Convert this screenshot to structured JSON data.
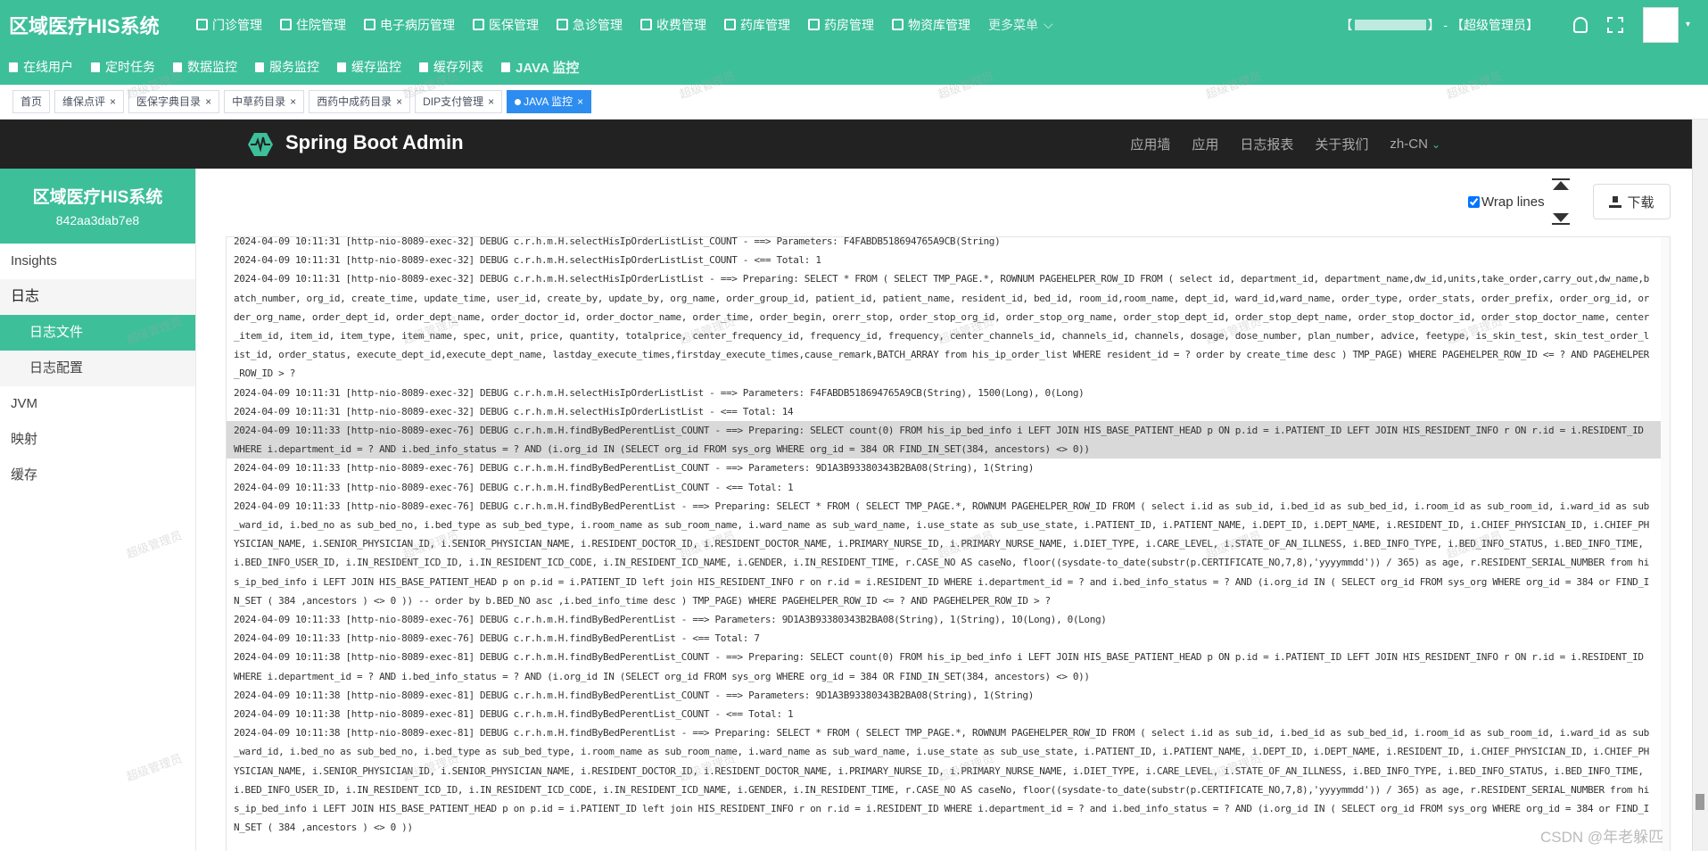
{
  "app": {
    "title": "区域医疗HIS系统",
    "nav": [
      {
        "label": "门诊管理"
      },
      {
        "label": "住院管理"
      },
      {
        "label": "电子病历管理"
      },
      {
        "label": "医保管理"
      },
      {
        "label": "急诊管理"
      },
      {
        "label": "收费管理"
      },
      {
        "label": "药库管理"
      },
      {
        "label": "药房管理"
      },
      {
        "label": "物资库管理"
      }
    ],
    "more_label": "更多菜单",
    "more_caret": "⌵",
    "user_prefix": "【",
    "user_suffix": "】 - 【超级管理员】",
    "avatar_caret": "▾"
  },
  "subnav": [
    {
      "label": "在线用户"
    },
    {
      "label": "定时任务"
    },
    {
      "label": "数据监控"
    },
    {
      "label": "服务监控"
    },
    {
      "label": "缓存监控"
    },
    {
      "label": "缓存列表"
    },
    {
      "label": "JAVA 监控"
    }
  ],
  "tabs": [
    {
      "label": "首页"
    },
    {
      "label": "维保点评",
      "close": "×"
    },
    {
      "label": "医保字典目录",
      "close": "×"
    },
    {
      "label": "中草药目录",
      "close": "×"
    },
    {
      "label": "西药中成药目录",
      "close": "×"
    },
    {
      "label": "DIP支付管理",
      "close": "×"
    },
    {
      "label": "JAVA 监控",
      "close": "×"
    }
  ],
  "sba": {
    "title": "Spring Boot Admin",
    "nav": [
      "应用墙",
      "应用",
      "日志报表",
      "关于我们"
    ],
    "lang": "zh-CN",
    "lang_caret": "⌄"
  },
  "sidebar": {
    "title": "区域医疗HIS系统",
    "instance_id": "842aa3dab7e8",
    "items": [
      {
        "label": "Insights"
      },
      {
        "label": "日志"
      },
      {
        "label": "日志文件"
      },
      {
        "label": "日志配置"
      },
      {
        "label": "JVM"
      },
      {
        "label": "映射"
      },
      {
        "label": "缓存"
      }
    ]
  },
  "logfile": {
    "wrap_label": "Wrap lines",
    "wrap_checked": true,
    "download_label": "下载",
    "lines": [
      "2024-04-09 10:11:31 [http-nio-8089-exec-32] DEBUG c.r.h.m.H.selectHisIpOrderListList_COUNT - ==> Parameters: F4FABDB518694765A9CB(String)",
      "2024-04-09 10:11:31 [http-nio-8089-exec-32] DEBUG c.r.h.m.H.selectHisIpOrderListList_COUNT - <==      Total: 1",
      "2024-04-09 10:11:31 [http-nio-8089-exec-32] DEBUG c.r.h.m.H.selectHisIpOrderListList - ==>  Preparing: SELECT * FROM ( SELECT TMP_PAGE.*, ROWNUM PAGEHELPER_ROW_ID FROM ( select id, department_id, department_name,dw_id,units,take_order,carry_out,dw_name,batch_number, org_id, create_time, update_time, user_id, create_by, update_by, org_name, order_group_id, patient_id, patient_name, resident_id, bed_id, room_id,room_name, dept_id, ward_id,ward_name, order_type, order_stats, order_prefix, order_org_id, order_org_name, order_dept_id, order_dept_name, order_doctor_id, order_doctor_name, order_time, order_begin, orerr_stop, order_stop_org_id, order_stop_org_name, order_stop_dept_id, order_stop_dept_name, order_stop_doctor_id, order_stop_doctor_name, center_item_id, item_id, item_type, item_name, spec, unit, price, quantity, totalprice, center_frequency_id, frequency_id, frequency, center_channels_id, channels_id, channels, dosage, dose_number, plan_number, advice, feetype, is_skin_test, skin_test_order_list_id, order_status, execute_dept_id,execute_dept_name, lastday_execute_times,firstday_execute_times,cause_remark,BATCH_ARRAY from his_ip_order_list WHERE resident_id = ? order by create_time desc ) TMP_PAGE) WHERE PAGEHELPER_ROW_ID <= ? AND PAGEHELPER_ROW_ID > ?",
      "2024-04-09 10:11:31 [http-nio-8089-exec-32] DEBUG c.r.h.m.H.selectHisIpOrderListList - ==> Parameters: F4FABDB518694765A9CB(String), 1500(Long), 0(Long)",
      "2024-04-09 10:11:31 [http-nio-8089-exec-32] DEBUG c.r.h.m.H.selectHisIpOrderListList - <==      Total: 14",
      "2024-04-09 10:11:33 [http-nio-8089-exec-76] DEBUG c.r.h.m.H.findByBedPerentList_COUNT - ==>  Preparing: SELECT count(0) FROM his_ip_bed_info i LEFT JOIN HIS_BASE_PATIENT_HEAD p ON p.id = i.PATIENT_ID LEFT JOIN HIS_RESIDENT_INFO r ON r.id = i.RESIDENT_ID WHERE i.department_id = ? AND i.bed_info_status = ? AND (i.org_id IN (SELECT org_id FROM sys_org WHERE org_id = 384 OR FIND_IN_SET(384, ancestors) <> 0))",
      "2024-04-09 10:11:33 [http-nio-8089-exec-76] DEBUG c.r.h.m.H.findByBedPerentList_COUNT - ==> Parameters: 9D1A3B93380343B2BA08(String), 1(String)",
      "2024-04-09 10:11:33 [http-nio-8089-exec-76] DEBUG c.r.h.m.H.findByBedPerentList_COUNT - <==      Total: 1",
      "2024-04-09 10:11:33 [http-nio-8089-exec-76] DEBUG c.r.h.m.H.findByBedPerentList - ==>  Preparing: SELECT * FROM ( SELECT TMP_PAGE.*, ROWNUM PAGEHELPER_ROW_ID FROM ( select i.id as sub_id, i.bed_id as sub_bed_id, i.room_id as sub_room_id, i.ward_id as sub_ward_id, i.bed_no as sub_bed_no, i.bed_type as sub_bed_type, i.room_name as sub_room_name, i.ward_name as sub_ward_name, i.use_state as sub_use_state, i.PATIENT_ID, i.PATIENT_NAME, i.DEPT_ID, i.DEPT_NAME, i.RESIDENT_ID, i.CHIEF_PHYSICIAN_ID, i.CHIEF_PHYSICIAN_NAME, i.SENIOR_PHYSICIAN_ID, i.SENIOR_PHYSICIAN_NAME, i.RESIDENT_DOCTOR_ID, i.RESIDENT_DOCTOR_NAME, i.PRIMARY_NURSE_ID, i.PRIMARY_NURSE_NAME, i.DIET_TYPE, i.CARE_LEVEL, i.STATE_OF_AN_ILLNESS, i.BED_INFO_TYPE, i.BED_INFO_STATUS, i.BED_INFO_TIME, i.BED_INFO_USER_ID, i.IN_RESIDENT_ICD_ID, i.IN_RESIDENT_ICD_CODE, i.IN_RESIDENT_ICD_NAME, i.GENDER, i.IN_RESIDENT_TIME, r.CASE_NO AS caseNo, floor((sysdate-to_date(substr(p.CERTIFICATE_NO,7,8),'yyyymmdd')) / 365) as age, r.RESIDENT_SERIAL_NUMBER from his_ip_bed_info i LEFT JOIN HIS_BASE_PATIENT_HEAD p on p.id = i.PATIENT_ID left join HIS_RESIDENT_INFO r on r.id = i.RESIDENT_ID WHERE i.department_id = ? and i.bed_info_status = ? AND (i.org_id IN ( SELECT org_id FROM sys_org WHERE org_id = 384 or FIND_IN_SET ( 384 ,ancestors ) <> 0 )) -- order by b.BED_NO asc ,i.bed_info_time desc ) TMP_PAGE) WHERE PAGEHELPER_ROW_ID <= ? AND PAGEHELPER_ROW_ID > ?",
      "2024-04-09 10:11:33 [http-nio-8089-exec-76] DEBUG c.r.h.m.H.findByBedPerentList - ==> Parameters: 9D1A3B93380343B2BA08(String), 1(String), 10(Long), 0(Long)",
      "2024-04-09 10:11:33 [http-nio-8089-exec-76] DEBUG c.r.h.m.H.findByBedPerentList - <==      Total: 7",
      "2024-04-09 10:11:38 [http-nio-8089-exec-81] DEBUG c.r.h.m.H.findByBedPerentList_COUNT - ==>  Preparing: SELECT count(0) FROM his_ip_bed_info i LEFT JOIN HIS_BASE_PATIENT_HEAD p ON p.id = i.PATIENT_ID LEFT JOIN HIS_RESIDENT_INFO r ON r.id = i.RESIDENT_ID WHERE i.department_id = ? AND i.bed_info_status = ? AND (i.org_id IN (SELECT org_id FROM sys_org WHERE org_id = 384 OR FIND_IN_SET(384, ancestors) <> 0))",
      "2024-04-09 10:11:38 [http-nio-8089-exec-81] DEBUG c.r.h.m.H.findByBedPerentList_COUNT - ==> Parameters: 9D1A3B93380343B2BA08(String), 1(String)",
      "2024-04-09 10:11:38 [http-nio-8089-exec-81] DEBUG c.r.h.m.H.findByBedPerentList_COUNT - <==      Total: 1",
      "2024-04-09 10:11:38 [http-nio-8089-exec-81] DEBUG c.r.h.m.H.findByBedPerentList - ==>  Preparing: SELECT * FROM ( SELECT TMP_PAGE.*, ROWNUM PAGEHELPER_ROW_ID FROM ( select i.id as sub_id, i.bed_id as sub_bed_id, i.room_id as sub_room_id, i.ward_id as sub_ward_id, i.bed_no as sub_bed_no, i.bed_type as sub_bed_type, i.room_name as sub_room_name, i.ward_name as sub_ward_name, i.use_state as sub_use_state, i.PATIENT_ID, i.PATIENT_NAME, i.DEPT_ID, i.DEPT_NAME, i.RESIDENT_ID, i.CHIEF_PHYSICIAN_ID, i.CHIEF_PHYSICIAN_NAME, i.SENIOR_PHYSICIAN_ID, i.SENIOR_PHYSICIAN_NAME, i.RESIDENT_DOCTOR_ID, i.RESIDENT_DOCTOR_NAME, i.PRIMARY_NURSE_ID, i.PRIMARY_NURSE_NAME, i.DIET_TYPE, i.CARE_LEVEL, i.STATE_OF_AN_ILLNESS, i.BED_INFO_TYPE, i.BED_INFO_STATUS, i.BED_INFO_TIME, i.BED_INFO_USER_ID, i.IN_RESIDENT_ICD_ID, i.IN_RESIDENT_ICD_CODE, i.IN_RESIDENT_ICD_NAME, i.GENDER, i.IN_RESIDENT_TIME, r.CASE_NO AS caseNo, floor((sysdate-to_date(substr(p.CERTIFICATE_NO,7,8),'yyyymmdd')) / 365) as age, r.RESIDENT_SERIAL_NUMBER from his_ip_bed_info i LEFT JOIN HIS_BASE_PATIENT_HEAD p on p.id = i.PATIENT_ID left join HIS_RESIDENT_INFO r on r.id = i.RESIDENT_ID WHERE i.department_id = ? and i.bed_info_status = ? AND (i.org_id IN ( SELECT org_id FROM sys_org WHERE org_id = 384 or FIND_IN_SET ( 384 ,ancestors ) <> 0 ))"
    ],
    "highlighted_index": 5
  },
  "watermark_text": "超级管理员",
  "corner_mark": "CSDN @年老躲匹",
  "colors": {
    "brand": "#3dbf9a",
    "sba_header": "#222222",
    "active_tab": "#2d8cf0"
  },
  "icons": {
    "bell": "bell-icon",
    "fullscreen": "fullscreen-icon",
    "download": "download-icon",
    "sba_logo": "heartbeat-logo-icon"
  }
}
